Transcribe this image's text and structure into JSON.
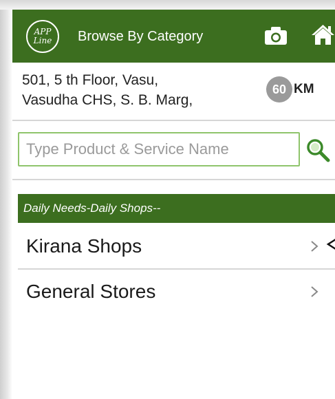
{
  "header": {
    "logo_line1": "APP",
    "logo_line2": "Line",
    "title": "Browse By Category",
    "camera_icon": "camera-icon",
    "home_icon": "home-icon",
    "background": "#3c6e1f"
  },
  "location": {
    "address_line1": "501, 5 th Floor, Vasu,",
    "address_line2": "Vasudha CHS, S. B. Marg,",
    "distance": "60",
    "distance_unit": "KM"
  },
  "search": {
    "placeholder": "Type Product & Service Name",
    "value": "",
    "icon": "search-icon",
    "border_color": "#8fc46b"
  },
  "section": {
    "title": "Daily Needs-Daily Shops--"
  },
  "categories": [
    {
      "label": "Kirana Shops",
      "icon": "chevron-right-icon"
    },
    {
      "label": "General Stores",
      "icon": "chevron-right-icon"
    }
  ]
}
